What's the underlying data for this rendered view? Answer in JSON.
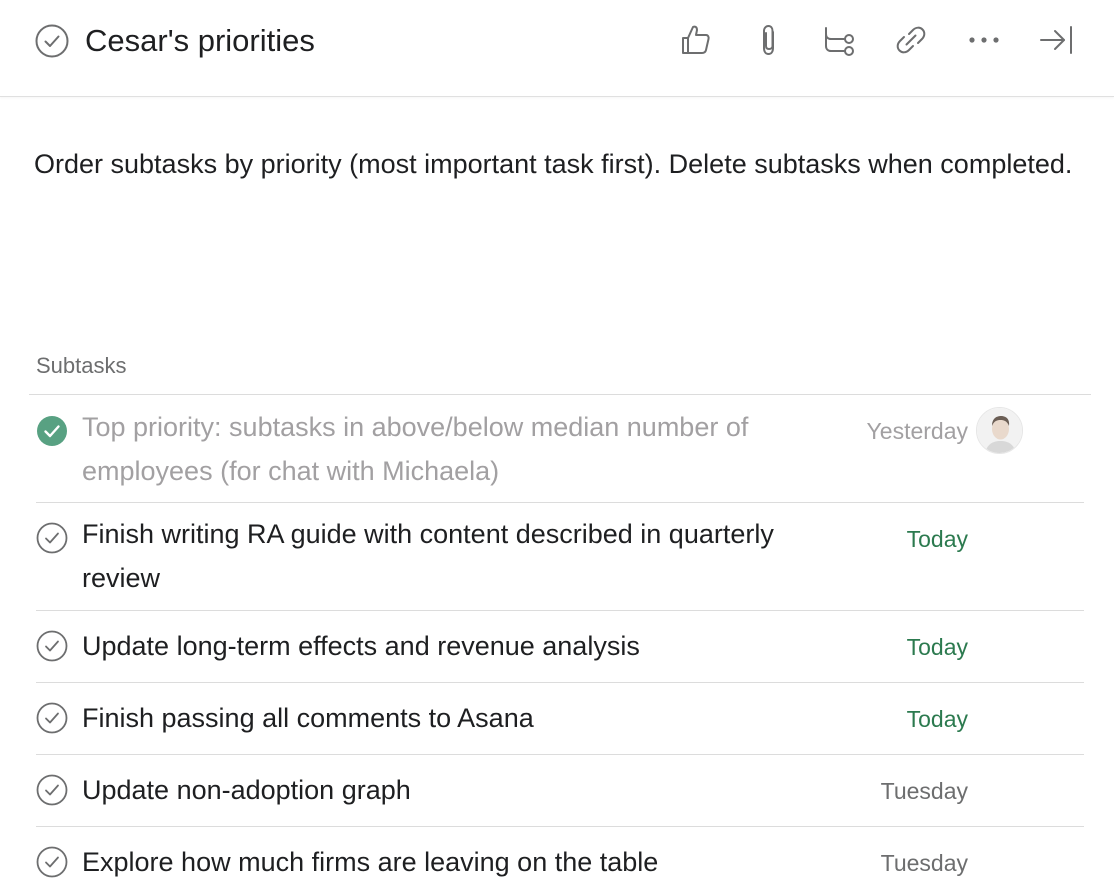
{
  "header": {
    "title": "Cesar's priorities",
    "toolbar": [
      {
        "name": "like-icon"
      },
      {
        "name": "attachment-icon"
      },
      {
        "name": "subtask-icon"
      },
      {
        "name": "link-icon"
      },
      {
        "name": "more-icon"
      },
      {
        "name": "close-pane-icon"
      }
    ]
  },
  "description": "Order subtasks by priority (most important task first). Delete subtasks when completed.",
  "subtasks": {
    "heading": "Subtasks",
    "items": [
      {
        "text": "Top priority: subtasks in above/below median number of employees (for chat with Michaela)",
        "date": "Yesterday",
        "completed": true,
        "has_avatar": true
      },
      {
        "text": "Finish writing RA guide with content described in quarterly review",
        "date": "Today",
        "completed": false,
        "has_avatar": false
      },
      {
        "text": "Update long-term effects and revenue analysis",
        "date": "Today",
        "completed": false,
        "has_avatar": false
      },
      {
        "text": "Finish passing all comments to Asana",
        "date": "Today",
        "completed": false,
        "has_avatar": false
      },
      {
        "text": "Update non-adoption graph",
        "date": "Tuesday",
        "completed": false,
        "has_avatar": false
      },
      {
        "text": "Explore how much firms are leaving on the table",
        "date": "Tuesday",
        "completed": false,
        "has_avatar": false
      }
    ]
  },
  "colors": {
    "completed_check": "#58a182",
    "today": "#2c7a4f",
    "muted_text": "#a2a0a2",
    "default_date": "#6d6e6f",
    "icon": "#6d6e6f"
  }
}
